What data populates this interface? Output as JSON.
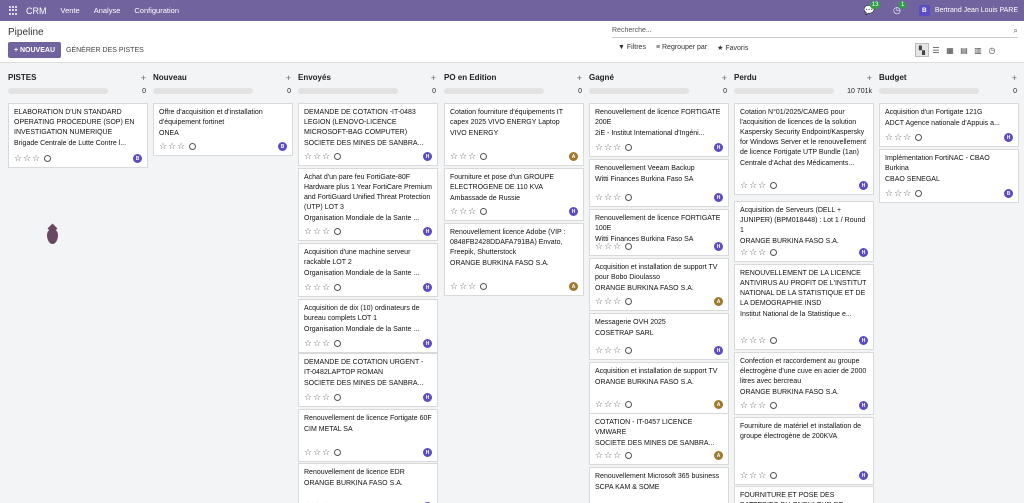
{
  "topbar": {
    "app": "CRM",
    "menus": [
      "Vente",
      "Analyse",
      "Configuration"
    ],
    "messages_count": "13",
    "activities_count": "1",
    "user_initial": "B",
    "user_name": "Bertrand Jean Louis PARE"
  },
  "control": {
    "title": "Pipeline",
    "new_label": "+ NOUVEAU",
    "generate_label": "GÉNÉRER DES PISTES",
    "search_placeholder": "Recherche...",
    "filters_label": "Filtres",
    "groupby_label": "Regrouper par",
    "favorites_label": "Favoris"
  },
  "colors": {
    "brand": "#71639e",
    "avatar_h": "#5b4bc4",
    "avatar_a": "#a0782d"
  },
  "columns": [
    {
      "name": "PISTES",
      "total": "0",
      "cards": [
        {
          "title": "ELABORATION D'UN STANDARD OPERATING PROCEDURE (SOP) EN INVESTIGATION NUMERIQUE",
          "company": "Brigade Centrale de Lutte Contre l...",
          "avatar": "B"
        }
      ]
    },
    {
      "name": "Nouveau",
      "total": "0",
      "cards": [
        {
          "title": "Offre d'acquisition et d'installation d'équipement fortinet",
          "company": "ONEA",
          "avatar": "B"
        }
      ]
    },
    {
      "name": "Envoyés",
      "total": "0",
      "cards": [
        {
          "title": "DEMANDE DE COTATION -IT-0483 LEGION (LENOVO-LICENCE MICROSOFT-BAG COMPUTER)",
          "company": "SOCIETE DES MINES DE SANBRA...",
          "avatar": "H"
        },
        {
          "title": "Achat d'un pare feu FortiGate-80F Hardware plus 1 Year FortiCare Premium and FortiGuard Unified Threat Protection (UTP) LOT 3",
          "company": "Organisation Mondiale de la Sante ...",
          "avatar": "H"
        },
        {
          "title": "Acquisition d'une machine serveur rackable LOT 2",
          "company": "Organisation Mondiale de la Sante ...",
          "avatar": "H"
        },
        {
          "title": "Acquisition de dix (10) ordinateurs de bureau complets LOT 1",
          "company": "Organisation Mondiale de la Sante ...",
          "avatar": "H"
        },
        {
          "title": "DEMANDE DE COTATION URGENT - IT-0482LAPTOP ROMAN",
          "company": "SOCIETE DES MINES DE SANBRA...",
          "avatar": "H"
        },
        {
          "title": "Renouvellement de licence Fortigate 60F",
          "company": "CIM METAL SA",
          "avatar": "H"
        },
        {
          "title": "Renouvellement de licence EDR",
          "company": "ORANGE BURKINA FASO S.A.",
          "avatar": "H"
        }
      ]
    },
    {
      "name": "PO en Edition",
      "total": "0",
      "cards": [
        {
          "title": "Cotation fourniture d'équipements IT capex 2025 VIVO ENERGY Laptop",
          "company": "VIVO ENERGY",
          "avatar": "A"
        },
        {
          "title": "Fourniture et pose d'un GROUPE ELECTROGENE DE 110 KVA",
          "company": "Ambassade de Russie",
          "avatar": "H"
        },
        {
          "title": "Renouvellement licence Adobe (VIP : 0848FB2428DDAFA791BA) Envato, Freepik, Shutterstock",
          "company": "ORANGE BURKINA FASO S.A.",
          "avatar": "A"
        }
      ]
    },
    {
      "name": "Gagné",
      "total": "0",
      "cards": [
        {
          "title": "Renouvellement de licence FORTIGATE 200E",
          "company": "2iE - Institut International d'Ingéni...",
          "avatar": "H"
        },
        {
          "title": "Renouvellement Veeam Backup",
          "company": "Witti Finances Burkina Faso SA",
          "avatar": "H"
        },
        {
          "title": "Renouvellement de licence FORTIGATE 100E",
          "company": "Witti Finances Burkina Faso SA",
          "avatar": "H"
        },
        {
          "title": "Acquisition et installation de support TV pour Bobo Dioulasso",
          "company": "ORANGE BURKINA FASO S.A.",
          "avatar": "A"
        },
        {
          "title": "Messagerie OVH 2025",
          "company": "COSETRAP SARL",
          "avatar": "H"
        },
        {
          "title": "Acquisition et installation de support TV",
          "company": "ORANGE BURKINA FASO S.A.",
          "avatar": "A"
        },
        {
          "title": "COTATION - IT-0457 LICENCE VMWARE",
          "company": "SOCIETE DES MINES DE SANBRA...",
          "avatar": "A"
        },
        {
          "title": "Renouvellement Microsoft 365 business",
          "company": "SCPA KAM & SOME",
          "avatar": ""
        }
      ]
    },
    {
      "name": "Perdu",
      "total": "10 701k",
      "cards": [
        {
          "title": "Cotation N°01/2025/CAMEG pour l'acquisition de licences de la solution Kaspersky Security Endpoint/Kaspersky for Windows Server et le renouvellement de licence Fortigate UTP Bundle (1an)",
          "company": "Centrale d'Achat des Médicaments...",
          "avatar": "H"
        },
        {
          "title": "Acquisition de Serveurs (DELL + JUNIPER) (BPM018448) : Lot 1 / Round 1",
          "company": "ORANGE BURKINA FASO S.A.",
          "avatar": "H"
        },
        {
          "title": "RENOUVELLEMENT DE LA LICENCE ANTIVIRUS AU PROFIT DE L'INSTITUT NATIONAL DE LA STATISTIQUE ET DE LA DEMOGRAPHIE INSD",
          "company": "Institut National de la Statistique e...",
          "avatar": "H"
        },
        {
          "title": "Confection et raccordement au groupe électrogène d'une cuve en acier de 2000 litres avec bercreau",
          "company": "ORANGE BURKINA FASO S.A.",
          "avatar": "H"
        },
        {
          "title": "Fourniture de matériel et installation de groupe électrogène de 200KVA",
          "company": "",
          "avatar": "H"
        },
        {
          "title": "FOURNITURE ET POSE DES BATTERIES DU ONDULEUR DE",
          "company": "",
          "avatar": ""
        }
      ]
    },
    {
      "name": "Budget",
      "total": "0",
      "cards": [
        {
          "title": "Acquisition d'un Fortigate 121G",
          "company": "ADCT Agence nationale d'Appuis a...",
          "avatar": "H"
        },
        {
          "title": "Implémentation FortiNAC - CBAO Burkina",
          "company": "CBAO SENEGAL",
          "avatar": "B"
        }
      ]
    }
  ]
}
